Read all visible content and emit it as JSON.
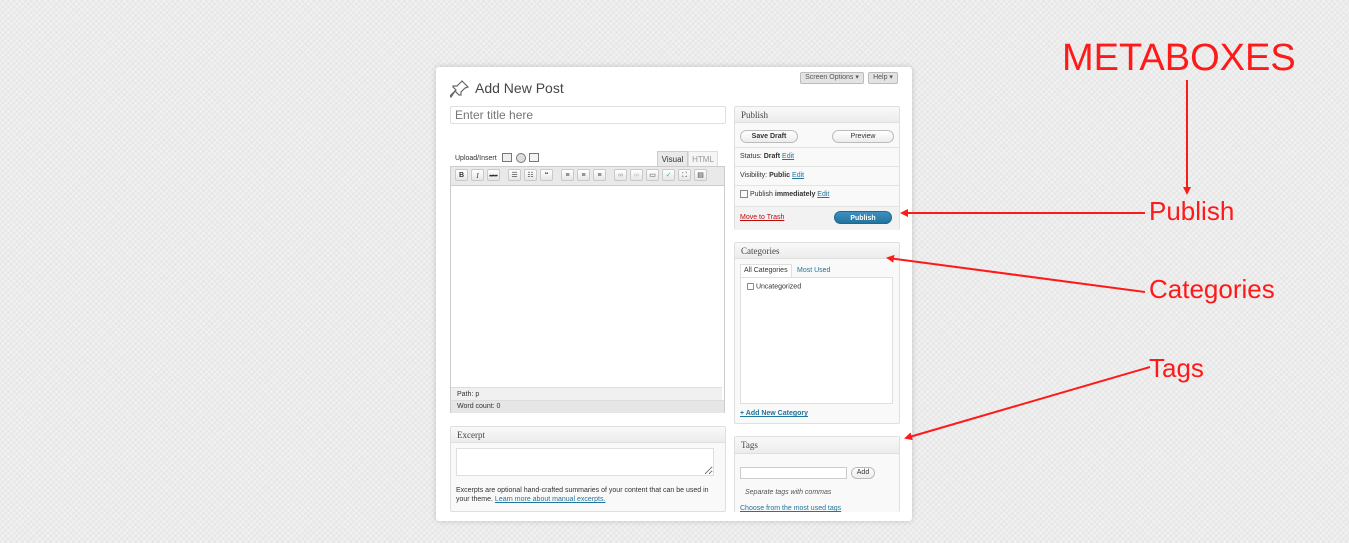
{
  "header": {
    "title": "Add New Post",
    "screen_options": "Screen Options",
    "help": "Help"
  },
  "title_field": {
    "placeholder": "Enter title here"
  },
  "editor": {
    "upload_insert": "Upload/Insert",
    "tab_visual": "Visual",
    "tab_html": "HTML",
    "toolbar": {
      "bold": "B",
      "italic": "I",
      "strike": "ABC",
      "quote": "“"
    },
    "path_label": "Path:",
    "path_value": "p",
    "word_count": "Word count: 0"
  },
  "excerpt": {
    "title": "Excerpt",
    "help_text": "Excerpts are optional hand-crafted summaries of your content that can be used in your theme.",
    "help_link": "Learn more about manual excerpts."
  },
  "publish": {
    "title": "Publish",
    "save_draft": "Save Draft",
    "preview": "Preview",
    "status_label": "Status:",
    "status_value": "Draft",
    "visibility_label": "Visibility:",
    "visibility_value": "Public",
    "publish_label": "Publish",
    "publish_value": "immediately",
    "edit": "Edit",
    "move_to_trash": "Move to Trash",
    "publish_button": "Publish"
  },
  "categories": {
    "title": "Categories",
    "tab_all": "All Categories",
    "tab_most_used": "Most Used",
    "items": [
      {
        "label": "Uncategorized",
        "checked": false
      }
    ],
    "add_new": "+ Add New Category"
  },
  "tags": {
    "title": "Tags",
    "add_button": "Add",
    "hint": "Separate tags with commas",
    "choose_link": "Choose from the most used tags"
  },
  "annotations": {
    "metaboxes": "METABOXES",
    "publish": "Publish",
    "categories": "Categories",
    "tags": "Tags",
    "color": "#ff1a1a"
  }
}
